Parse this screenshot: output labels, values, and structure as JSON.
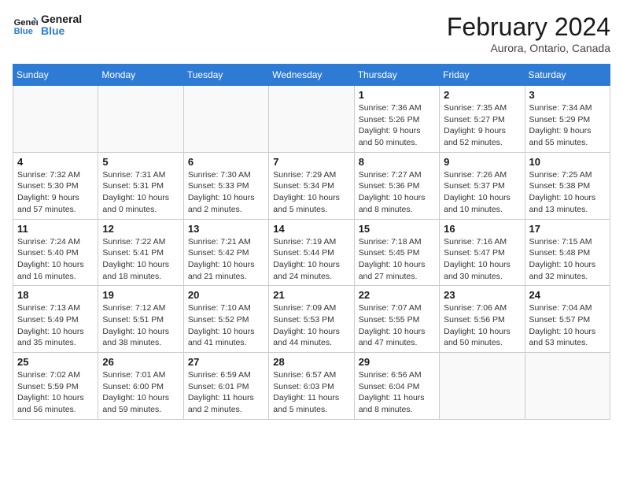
{
  "logo": {
    "text_general": "General",
    "text_blue": "Blue"
  },
  "header": {
    "month": "February 2024",
    "location": "Aurora, Ontario, Canada"
  },
  "days_of_week": [
    "Sunday",
    "Monday",
    "Tuesday",
    "Wednesday",
    "Thursday",
    "Friday",
    "Saturday"
  ],
  "weeks": [
    [
      {
        "day": "",
        "info": ""
      },
      {
        "day": "",
        "info": ""
      },
      {
        "day": "",
        "info": ""
      },
      {
        "day": "",
        "info": ""
      },
      {
        "day": "1",
        "info": "Sunrise: 7:36 AM\nSunset: 5:26 PM\nDaylight: 9 hours and 50 minutes."
      },
      {
        "day": "2",
        "info": "Sunrise: 7:35 AM\nSunset: 5:27 PM\nDaylight: 9 hours and 52 minutes."
      },
      {
        "day": "3",
        "info": "Sunrise: 7:34 AM\nSunset: 5:29 PM\nDaylight: 9 hours and 55 minutes."
      }
    ],
    [
      {
        "day": "4",
        "info": "Sunrise: 7:32 AM\nSunset: 5:30 PM\nDaylight: 9 hours and 57 minutes."
      },
      {
        "day": "5",
        "info": "Sunrise: 7:31 AM\nSunset: 5:31 PM\nDaylight: 10 hours and 0 minutes."
      },
      {
        "day": "6",
        "info": "Sunrise: 7:30 AM\nSunset: 5:33 PM\nDaylight: 10 hours and 2 minutes."
      },
      {
        "day": "7",
        "info": "Sunrise: 7:29 AM\nSunset: 5:34 PM\nDaylight: 10 hours and 5 minutes."
      },
      {
        "day": "8",
        "info": "Sunrise: 7:27 AM\nSunset: 5:36 PM\nDaylight: 10 hours and 8 minutes."
      },
      {
        "day": "9",
        "info": "Sunrise: 7:26 AM\nSunset: 5:37 PM\nDaylight: 10 hours and 10 minutes."
      },
      {
        "day": "10",
        "info": "Sunrise: 7:25 AM\nSunset: 5:38 PM\nDaylight: 10 hours and 13 minutes."
      }
    ],
    [
      {
        "day": "11",
        "info": "Sunrise: 7:24 AM\nSunset: 5:40 PM\nDaylight: 10 hours and 16 minutes."
      },
      {
        "day": "12",
        "info": "Sunrise: 7:22 AM\nSunset: 5:41 PM\nDaylight: 10 hours and 18 minutes."
      },
      {
        "day": "13",
        "info": "Sunrise: 7:21 AM\nSunset: 5:42 PM\nDaylight: 10 hours and 21 minutes."
      },
      {
        "day": "14",
        "info": "Sunrise: 7:19 AM\nSunset: 5:44 PM\nDaylight: 10 hours and 24 minutes."
      },
      {
        "day": "15",
        "info": "Sunrise: 7:18 AM\nSunset: 5:45 PM\nDaylight: 10 hours and 27 minutes."
      },
      {
        "day": "16",
        "info": "Sunrise: 7:16 AM\nSunset: 5:47 PM\nDaylight: 10 hours and 30 minutes."
      },
      {
        "day": "17",
        "info": "Sunrise: 7:15 AM\nSunset: 5:48 PM\nDaylight: 10 hours and 32 minutes."
      }
    ],
    [
      {
        "day": "18",
        "info": "Sunrise: 7:13 AM\nSunset: 5:49 PM\nDaylight: 10 hours and 35 minutes."
      },
      {
        "day": "19",
        "info": "Sunrise: 7:12 AM\nSunset: 5:51 PM\nDaylight: 10 hours and 38 minutes."
      },
      {
        "day": "20",
        "info": "Sunrise: 7:10 AM\nSunset: 5:52 PM\nDaylight: 10 hours and 41 minutes."
      },
      {
        "day": "21",
        "info": "Sunrise: 7:09 AM\nSunset: 5:53 PM\nDaylight: 10 hours and 44 minutes."
      },
      {
        "day": "22",
        "info": "Sunrise: 7:07 AM\nSunset: 5:55 PM\nDaylight: 10 hours and 47 minutes."
      },
      {
        "day": "23",
        "info": "Sunrise: 7:06 AM\nSunset: 5:56 PM\nDaylight: 10 hours and 50 minutes."
      },
      {
        "day": "24",
        "info": "Sunrise: 7:04 AM\nSunset: 5:57 PM\nDaylight: 10 hours and 53 minutes."
      }
    ],
    [
      {
        "day": "25",
        "info": "Sunrise: 7:02 AM\nSunset: 5:59 PM\nDaylight: 10 hours and 56 minutes."
      },
      {
        "day": "26",
        "info": "Sunrise: 7:01 AM\nSunset: 6:00 PM\nDaylight: 10 hours and 59 minutes."
      },
      {
        "day": "27",
        "info": "Sunrise: 6:59 AM\nSunset: 6:01 PM\nDaylight: 11 hours and 2 minutes."
      },
      {
        "day": "28",
        "info": "Sunrise: 6:57 AM\nSunset: 6:03 PM\nDaylight: 11 hours and 5 minutes."
      },
      {
        "day": "29",
        "info": "Sunrise: 6:56 AM\nSunset: 6:04 PM\nDaylight: 11 hours and 8 minutes."
      },
      {
        "day": "",
        "info": ""
      },
      {
        "day": "",
        "info": ""
      }
    ]
  ]
}
